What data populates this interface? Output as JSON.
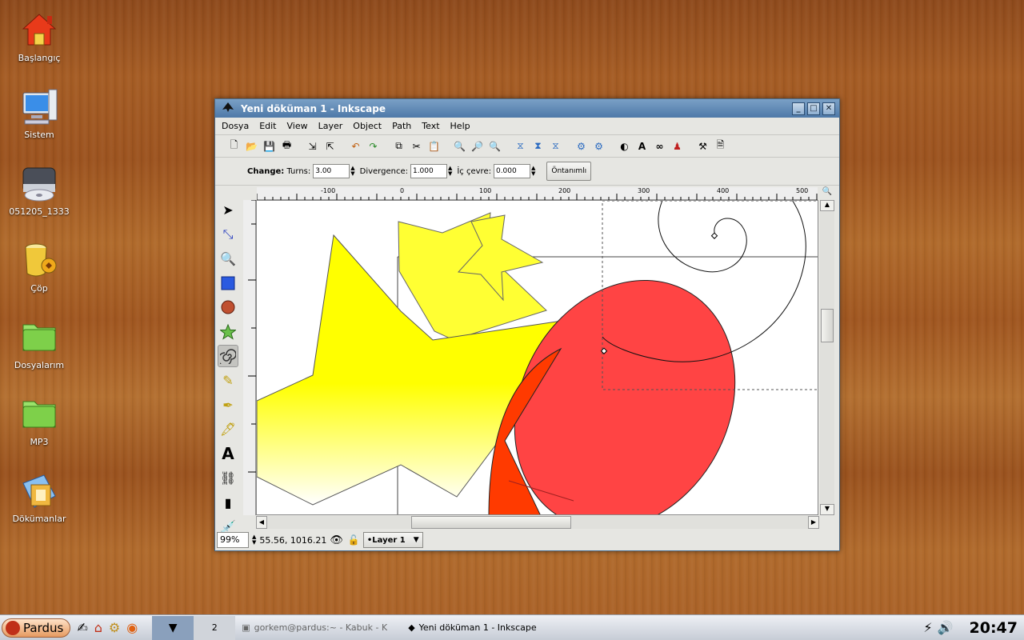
{
  "desktop_icons": [
    {
      "label": "Başlangıç",
      "icon": "home-icon"
    },
    {
      "label": "Sistem",
      "icon": "computer-icon"
    },
    {
      "label": "051205_1333",
      "icon": "cdrom-icon"
    },
    {
      "label": "Çöp",
      "icon": "trash-icon"
    },
    {
      "label": "Dosyalarım",
      "icon": "folder-icon"
    },
    {
      "label": "MP3",
      "icon": "folder-icon"
    },
    {
      "label": "Dökümanlar",
      "icon": "documents-icon"
    }
  ],
  "window": {
    "title": "Yeni döküman 1 - Inkscape",
    "menu": [
      "Dosya",
      "Edit",
      "View",
      "Layer",
      "Object",
      "Path",
      "Text",
      "Help"
    ]
  },
  "spiral_toolbar": {
    "change_label": "Change:",
    "turns_label": "Turns:",
    "turns_value": "3.00",
    "divergence_label": "Divergence:",
    "divergence_value": "1.000",
    "inner_label": "İç çevre:",
    "inner_value": "0.000",
    "defaults_button": "Öntanımlı"
  },
  "ruler": {
    "ticks": [
      "-100",
      "0",
      "100",
      "200",
      "300",
      "400",
      "500"
    ]
  },
  "status": {
    "zoom": "99%",
    "coords": "55.56, 1016.21",
    "layer": "•Layer 1"
  },
  "colors": {
    "star": "#ffff00",
    "ellipse": "#ff4040",
    "title_bar": "#5a86b4"
  },
  "taskbar": {
    "start_label": "Pardus",
    "desktop_number": "2",
    "tasks": [
      "gorkem@pardus:~ - Kabuk - K",
      "Yeni döküman 1 - Inkscape"
    ],
    "clock": "20:47"
  }
}
